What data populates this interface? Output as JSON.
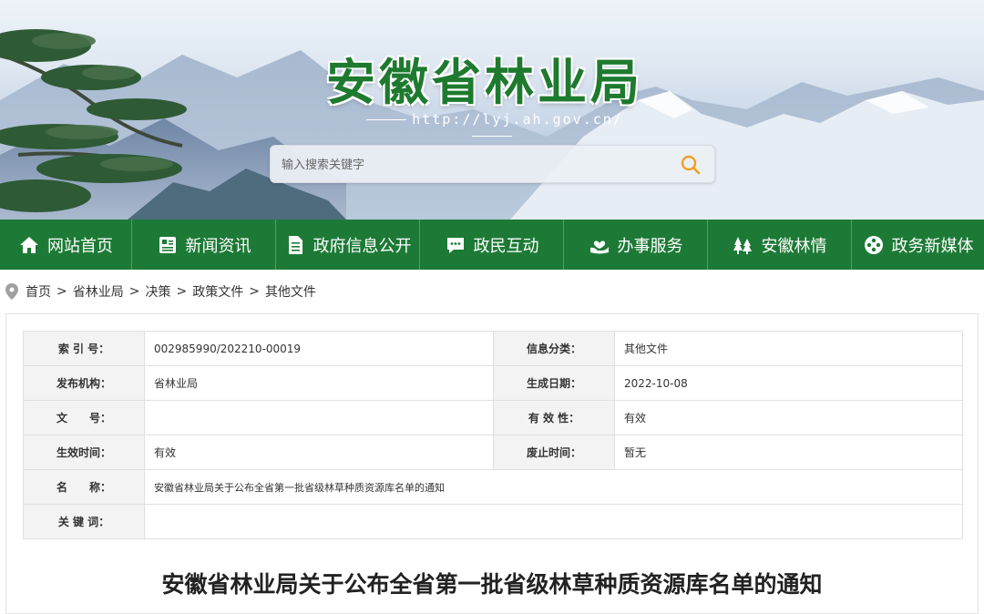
{
  "header": {
    "site_title": "安徽省林业局",
    "site_url": "http://lyj.ah.gov.cn/",
    "search_placeholder": "输入搜索关键字"
  },
  "nav": {
    "items": [
      {
        "label": "网站首页",
        "icon": "home-icon"
      },
      {
        "label": "新闻资讯",
        "icon": "news-icon"
      },
      {
        "label": "政府信息公开",
        "icon": "document-icon"
      },
      {
        "label": "政民互动",
        "icon": "chat-icon"
      },
      {
        "label": "办事服务",
        "icon": "hand-heart-icon"
      },
      {
        "label": "安徽林情",
        "icon": "trees-icon"
      },
      {
        "label": "政务新媒体",
        "icon": "media-icon"
      }
    ]
  },
  "breadcrumb": {
    "items": [
      "首页",
      "省林业局",
      "决策",
      "政策文件",
      "其他文件"
    ],
    "separator": ">"
  },
  "meta": {
    "index_label": "索 引 号：",
    "index_value": "002985990/202210-00019",
    "category_label": "信息分类：",
    "category_value": "其他文件",
    "publisher_label": "发布机构：",
    "publisher_value": "省林业局",
    "date_label": "生成日期：",
    "date_value": "2022-10-08",
    "docno_label": "文　　号：",
    "docno_value": "",
    "validity_label": "有 效 性：",
    "validity_value": "有效",
    "effective_label": "生效时间：",
    "effective_value": "有效",
    "expire_label": "废止时间：",
    "expire_value": "暂无",
    "name_label": "名　　称：",
    "name_value": "安徽省林业局关于公布全省第一批省级林草种质资源库名单的通知",
    "keywords_label": "关 键 词：",
    "keywords_value": ""
  },
  "document": {
    "title": "安徽省林业局关于公布全省第一批省级林草种质资源库名单的通知"
  },
  "colors": {
    "nav_green": "#1d7a36",
    "title_green": "#1e7a2e",
    "search_icon": "#f0a020"
  }
}
